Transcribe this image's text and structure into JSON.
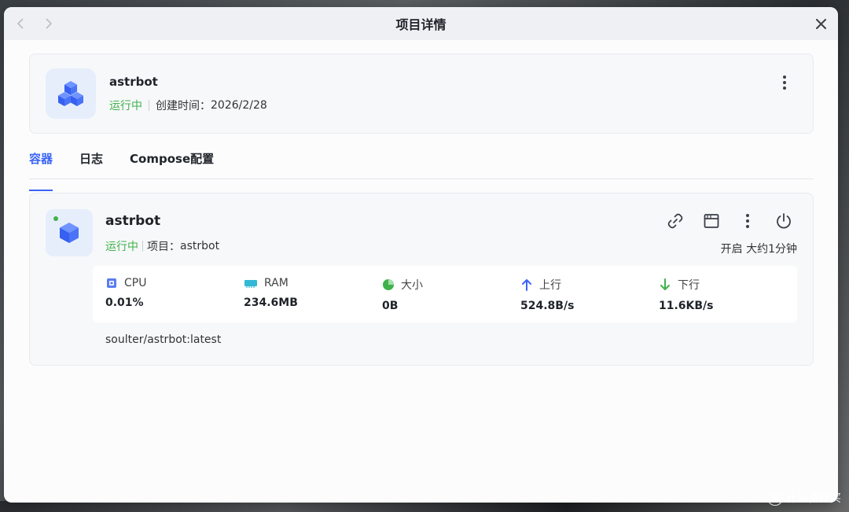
{
  "window": {
    "title": "项目详情",
    "nav_back_icon": "chevron-left-icon",
    "nav_forward_icon": "chevron-right-icon",
    "close_icon": "close-icon"
  },
  "project": {
    "name": "astrbot",
    "status": "运行中",
    "created_label": "创建时间：",
    "created_value": "2026/2/28",
    "icon": "cubes-icon"
  },
  "tabs": [
    {
      "label": "容器",
      "active": true
    },
    {
      "label": "日志",
      "active": false
    },
    {
      "label": "Compose配置",
      "active": false
    }
  ],
  "container": {
    "name": "astrbot",
    "status": "运行中",
    "project_label": "项目：",
    "project_value": "astrbot",
    "uptime": "开启 大约1分钟",
    "image": "soulter/astrbot:latest",
    "actions": [
      "link-icon",
      "terminal-window-icon",
      "more-vertical-icon",
      "power-icon"
    ],
    "stats": [
      {
        "label": "CPU",
        "value": "0.01%",
        "icon": "cpu-icon"
      },
      {
        "label": "RAM",
        "value": "234.6MB",
        "icon": "ram-icon"
      },
      {
        "label": "大小",
        "value": "0B",
        "icon": "pie-chart-icon"
      },
      {
        "label": "上行",
        "value": "524.8B/s",
        "icon": "arrow-up-icon"
      },
      {
        "label": "下行",
        "value": "11.6KB/s",
        "icon": "arrow-down-icon"
      }
    ]
  },
  "watermark": {
    "text": "什么值得买",
    "badge": "值"
  },
  "colors": {
    "accent": "#3a64f5",
    "running": "#3fb24a"
  }
}
